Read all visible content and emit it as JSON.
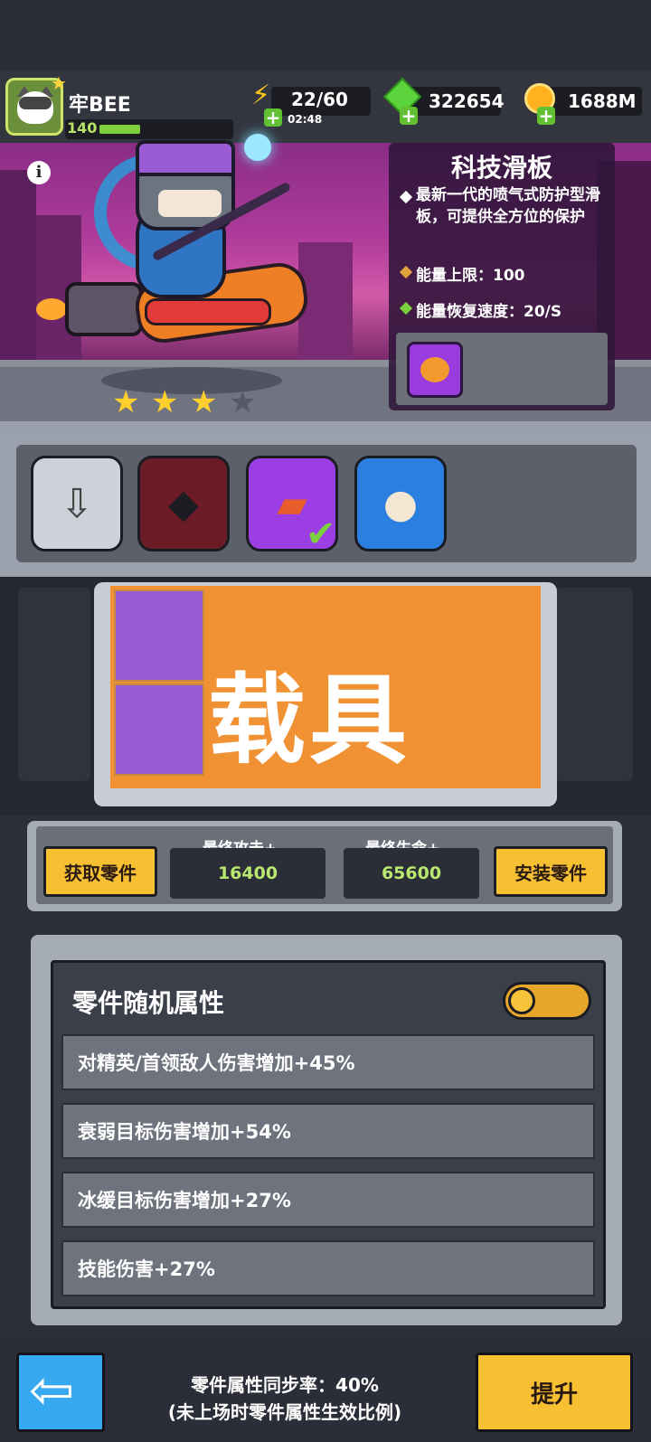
{
  "header": {
    "player_name": "牢BEE",
    "level": "140",
    "level_progress": 0.25,
    "energy": "22/60",
    "energy_timer": "02:48",
    "gems": "322654",
    "coins": "1688M"
  },
  "hero": {
    "stars_total": 4,
    "stars_filled": 3
  },
  "item": {
    "name": "科技滑板",
    "description": "最新一代的喷气式防护型滑板，可提供全方位的保护",
    "energy_cap": "能量上限：100",
    "energy_recovery": "能量恢复速度：20/S"
  },
  "slots": [
    {
      "icon": "download-icon"
    },
    {
      "icon": "dark-beast-icon"
    },
    {
      "icon": "skateboard-icon",
      "selected": true
    },
    {
      "icon": "gadget-icon"
    }
  ],
  "vehicle": {
    "title": "载具"
  },
  "stats": {
    "get_parts_label": "获取零件",
    "install_parts_label": "安装零件",
    "attack_label": "最终攻击+",
    "attack_value": "16400",
    "hp_label": "最终生命+",
    "hp_value": "65600"
  },
  "attributes": {
    "title": "零件随机属性",
    "toggle_on": true,
    "items": [
      "对精英/首领敌人伤害增加+45%",
      "衰弱目标伤害增加+54%",
      "冰缓目标伤害增加+27%",
      "技能伤害+27%"
    ]
  },
  "footer": {
    "sync_line1": "零件属性同步率：40%",
    "sync_line2": "(未上场时零件属性生效比例)",
    "upgrade_label": "提升"
  },
  "colors": {
    "accent_yellow": "#f7c033",
    "green_text": "#b8e870",
    "panel_gray": "#6e737d"
  }
}
